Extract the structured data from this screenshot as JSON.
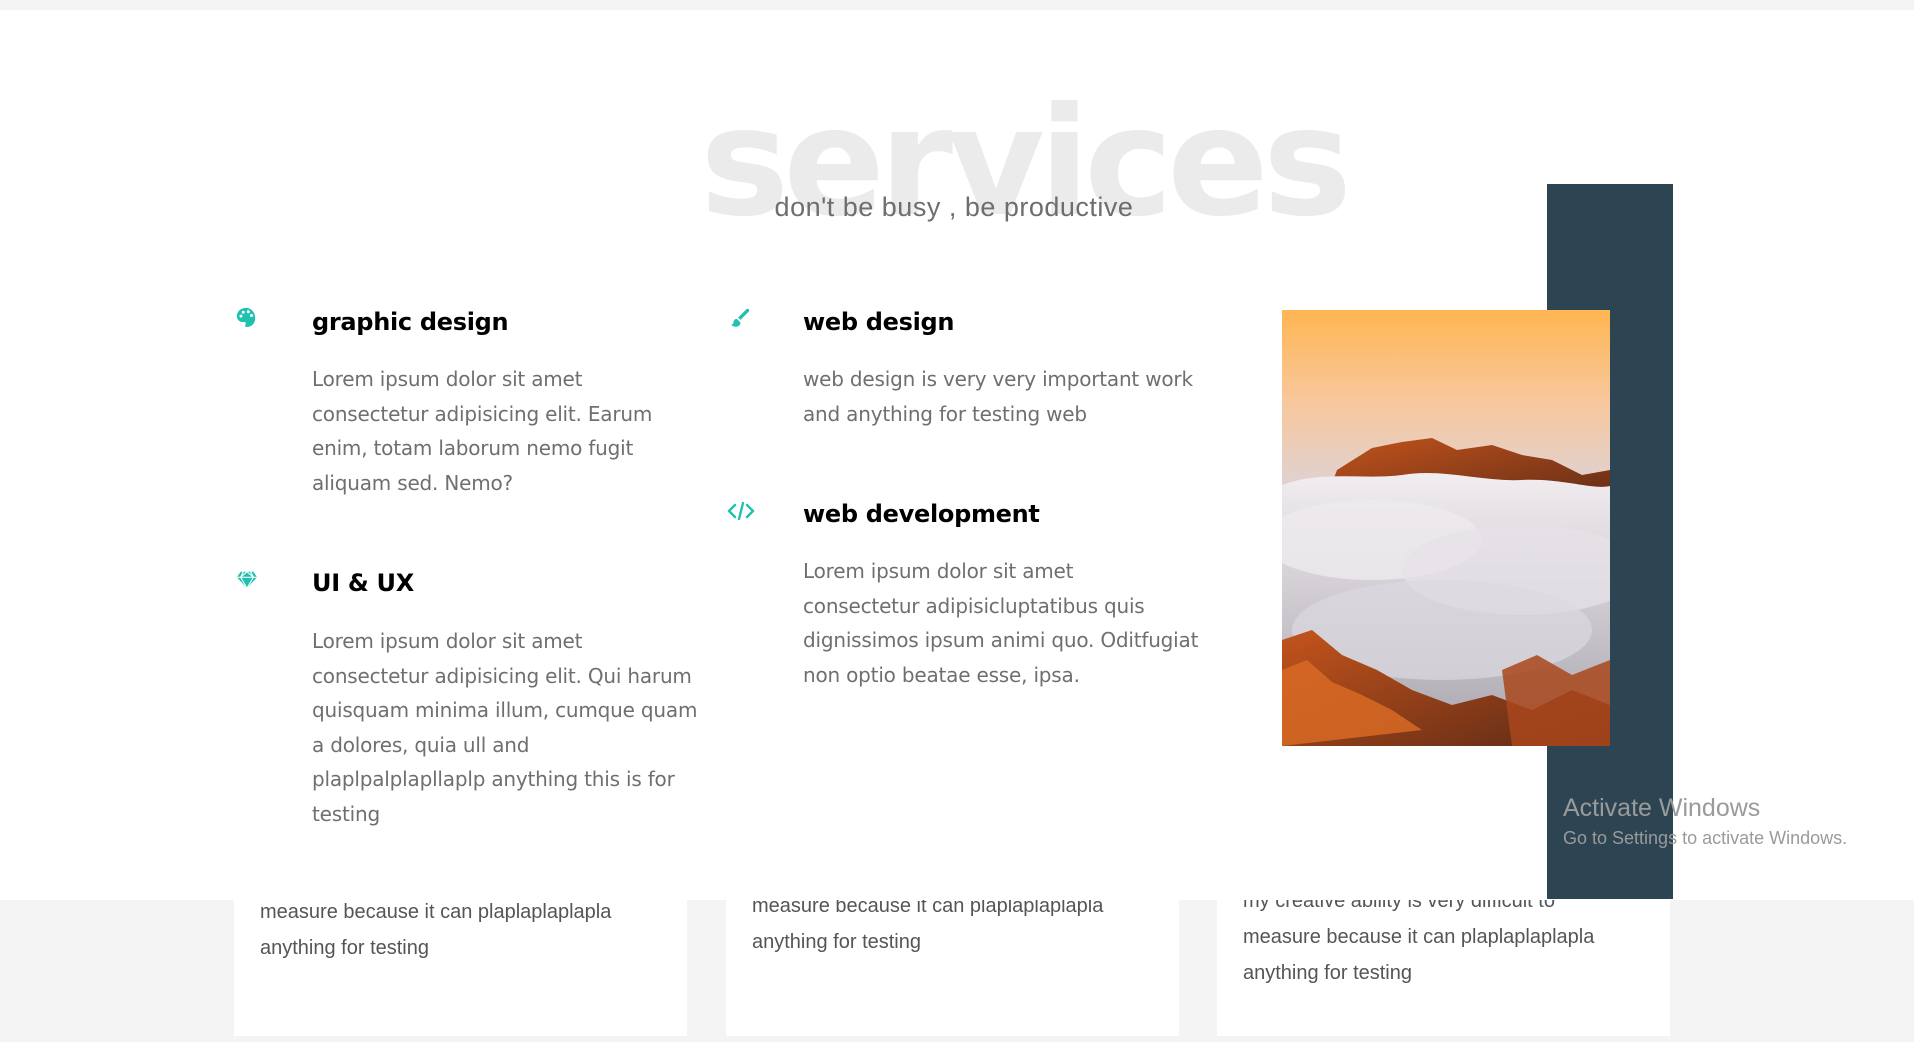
{
  "header": {
    "background_title": "services",
    "subtitle": "don't be busy , be productive"
  },
  "services": [
    {
      "icon": "palette-icon",
      "title": "graphic design",
      "description_lines": [
        "Lorem ipsum dolor sit amet",
        "consectetur adipisicing elit. Earum",
        "enim, totam laborum nemo fugit",
        "aliquam sed. Nemo?"
      ]
    },
    {
      "icon": "gem-icon",
      "title": "UI & UX",
      "description_lines": [
        "Lorem ipsum dolor sit amet",
        "consectetur adipisicing elit. Qui harum",
        "quisquam minima illum, cumque quam",
        "a dolores, quia ull and",
        "plaplpalplapllaplp anything this is for",
        "testing"
      ]
    },
    {
      "icon": "brush-icon",
      "title": "web design",
      "description_lines": [
        "web design is very very important work",
        "and anything for testing web"
      ]
    },
    {
      "icon": "code-icon",
      "title": "web development",
      "description_lines": [
        "Lorem ipsum dolor sit amet",
        "consectetur adipisicluptatibus quis",
        "dignissimos ipsum animi quo. Oditfugiat",
        "non optio beatae esse, ipsa."
      ]
    }
  ],
  "colors": {
    "accent": "#20c1b0",
    "panel": "#2d4553",
    "heading": "#000000",
    "body_text": "#6f6f6f",
    "watermark_title": "#ebebeb"
  },
  "cards": [
    {
      "lines": [
        "measure because it can plaplaplaplapla",
        "anything for testing"
      ]
    },
    {
      "lines": [
        "measure because it can plaplaplaplapla",
        "anything for testing"
      ]
    },
    {
      "lines": [
        "my creative ability is very difficult to",
        "measure because it can plaplaplaplapla",
        "anything for testing"
      ]
    }
  ],
  "image": {
    "subject": "mountain peaks above a sea of clouds at sunset"
  },
  "watermark": {
    "title": "Activate Windows",
    "subtitle": "Go to Settings to activate Windows."
  }
}
